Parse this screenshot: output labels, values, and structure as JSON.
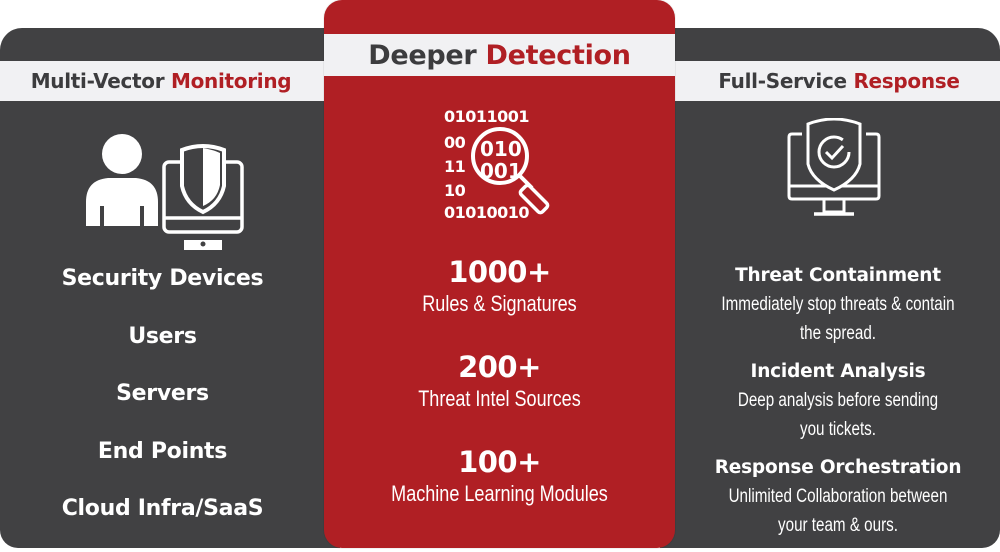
{
  "colors": {
    "dark": "#414143",
    "accent_red": "#b01f24",
    "band": "#f1f1f3",
    "band_text": "#3c3c3e",
    "white": "#ffffff"
  },
  "left": {
    "title_plain": "Multi-Vector ",
    "title_accent": "Monitoring",
    "icons": [
      "user-icon",
      "monitor-shield-icon"
    ],
    "items": [
      "Security Devices",
      "Users",
      "Servers",
      "End Points",
      "Cloud Infra/SaaS"
    ]
  },
  "center": {
    "title_plain": "Deeper ",
    "title_accent": "Detection",
    "icon": "binary-magnifier-icon",
    "binary_lines": [
      "01011001",
      "00",
      "11",
      "10",
      "01010010"
    ],
    "lens_lines": [
      "010",
      "001"
    ],
    "stats": [
      {
        "value": "1000+",
        "label": "Rules & Signatures"
      },
      {
        "value": "200+",
        "label": "Threat Intel Sources"
      },
      {
        "value": "100+",
        "label": "Machine Learning Modules"
      }
    ]
  },
  "right": {
    "title_plain": "Full-Service ",
    "title_accent": "Response",
    "icon": "monitor-shield-check-icon",
    "items": [
      {
        "title": "Threat Containment",
        "desc_1": "Immediately stop threats & contain",
        "desc_2": "the spread."
      },
      {
        "title": "Incident Analysis",
        "desc_1": "Deep analysis before sending",
        "desc_2": "you tickets."
      },
      {
        "title": "Response Orchestration",
        "desc_1": "Unlimited Collaboration between",
        "desc_2": "your team & ours."
      }
    ]
  }
}
